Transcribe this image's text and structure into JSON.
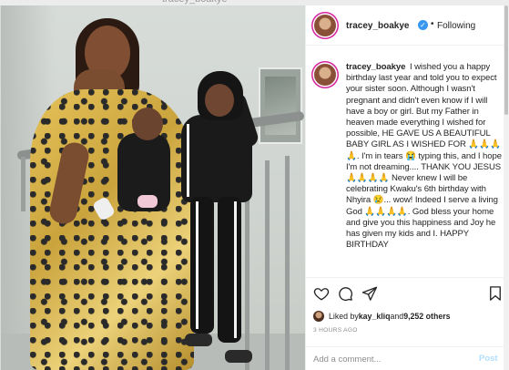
{
  "window": {
    "title": "tracey_boakye"
  },
  "header": {
    "username": "tracey_boakye",
    "verified_symbol": "✓",
    "separator": "•",
    "follow_label": "Following"
  },
  "caption": {
    "username": "tracey_boakye",
    "text": "I wished you a happy birthday last year and told you to expect your sister soon. Although I wasn't pregnant and didn't even know if I will have a boy or girl. But my Father in heaven made everything I wished for possible, HE GAVE US A BEAUTIFUL BABY GIRL AS I WISHED FOR 🙏🙏🙏🙏. I'm in tears 😭 typing this, and I hope I'm not dreaming.... THANK YOU JESUS 🙏🙏🙏🙏 Never knew I will be celebrating Kwaku's 6th birthday with Nhyira 😢... wow! Indeed I serve a living God 🙏🙏🙏🙏. God bless your home and give you this happiness and Joy he has given my kids and I. HAPPY BIRTHDAY"
  },
  "actions": {
    "icons": [
      "heart-icon",
      "comment-icon",
      "share-icon",
      "bookmark-icon"
    ]
  },
  "likes": {
    "prefix": "Liked by ",
    "liker": "kay_kliq",
    "middle": " and ",
    "count": "9,252 others"
  },
  "timestamp": "3 HOURS AGO",
  "add_comment": {
    "placeholder": "Add a comment...",
    "post_label": "Post"
  },
  "colors": {
    "accent": "#3897f0",
    "post_disabled": "#b2dffc",
    "text": "#262626",
    "muted": "#8e8e8e"
  }
}
